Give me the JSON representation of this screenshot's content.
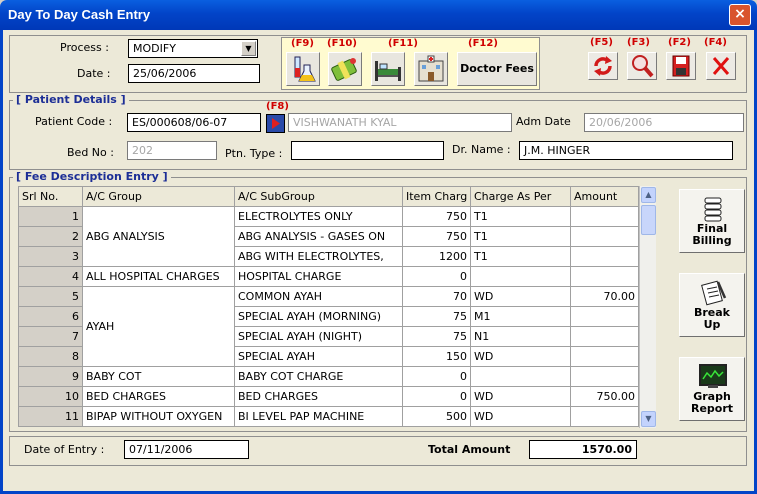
{
  "window": {
    "title": "Day To Day Cash Entry",
    "close_glyph": "×"
  },
  "form": {
    "process_label": "Process :",
    "process_value": "MODIFY",
    "date_label": "Date :",
    "date_value": "25/06/2006"
  },
  "toolbar": {
    "keys": [
      "(F9)",
      "(F10)",
      "(F11)",
      "(F12)"
    ],
    "doctor_fees_label": "Doctor Fees"
  },
  "actions": {
    "keys": [
      "(F5)",
      "(F3)",
      "(F2)",
      "(F4)"
    ],
    "icons": [
      "refresh-icon",
      "search-icon",
      "save-icon",
      "close-icon"
    ]
  },
  "patient": {
    "legend": "[ Patient Details ]",
    "f8_key": "(F8)",
    "code_label": "Patient Code :",
    "code_value": "ES/000608/06-07",
    "name_value": "VISHWANATH KYAL",
    "adm_date_label": "Adm Date",
    "adm_date_value": "20/06/2006",
    "bed_label": "Bed No :",
    "bed_value": "202",
    "ptn_type_label": "Ptn. Type :",
    "ptn_type_value": "",
    "dr_name_label": "Dr. Name :",
    "dr_name_value": "J.M. HINGER"
  },
  "fees": {
    "legend": "[ Fee Description Entry ]",
    "columns": [
      "Srl No.",
      "A/C Group",
      "A/C SubGroup",
      "Item Charg",
      "Charge As Per",
      "Amount"
    ],
    "rows": [
      {
        "srl": "1",
        "subgroup": "ELECTROLYTES ONLY",
        "item_charge": "750",
        "charge_as_per": "T1",
        "amount": ""
      },
      {
        "srl": "2",
        "subgroup": "ABG ANALYSIS - GASES ON",
        "item_charge": "750",
        "charge_as_per": "T1",
        "amount": ""
      },
      {
        "srl": "3",
        "subgroup": "ABG WITH ELECTROLYTES,",
        "item_charge": "1200",
        "charge_as_per": "T1",
        "amount": ""
      },
      {
        "srl": "4",
        "group": "ALL HOSPITAL CHARGES",
        "subgroup": "HOSPITAL CHARGE",
        "item_charge": "0",
        "charge_as_per": "",
        "amount": ""
      },
      {
        "srl": "5",
        "subgroup": "COMMON AYAH",
        "item_charge": "70",
        "charge_as_per": "WD",
        "amount": "70.00"
      },
      {
        "srl": "6",
        "subgroup": "SPECIAL AYAH (MORNING)",
        "item_charge": "75",
        "charge_as_per": "M1",
        "amount": ""
      },
      {
        "srl": "7",
        "subgroup": "SPECIAL AYAH (NIGHT)",
        "item_charge": "75",
        "charge_as_per": "N1",
        "amount": ""
      },
      {
        "srl": "8",
        "subgroup": "SPECIAL AYAH",
        "item_charge": "150",
        "charge_as_per": "WD",
        "amount": ""
      },
      {
        "srl": "9",
        "group": "BABY COT",
        "subgroup": "BABY COT CHARGE",
        "item_charge": "0",
        "charge_as_per": "",
        "amount": ""
      },
      {
        "srl": "10",
        "group": "BED CHARGES",
        "subgroup": "BED CHARGES",
        "item_charge": "0",
        "charge_as_per": "WD",
        "amount": "750.00"
      },
      {
        "srl": "11",
        "group": "BIPAP WITHOUT OXYGEN",
        "subgroup": "BI LEVEL PAP MACHINE",
        "item_charge": "500",
        "charge_as_per": "WD",
        "amount": ""
      }
    ],
    "merged_groups": {
      "abg": "ABG ANALYSIS",
      "ayah": "AYAH"
    }
  },
  "side_buttons": {
    "final_billing": [
      "Final",
      "Billing"
    ],
    "break_up": [
      "Break",
      "Up"
    ],
    "graph_report": [
      "Graph",
      "Report"
    ]
  },
  "footer": {
    "date_of_entry_label": "Date of Entry :",
    "date_of_entry_value": "07/11/2006",
    "total_label": "Total Amount",
    "total_value": "1570.00"
  }
}
